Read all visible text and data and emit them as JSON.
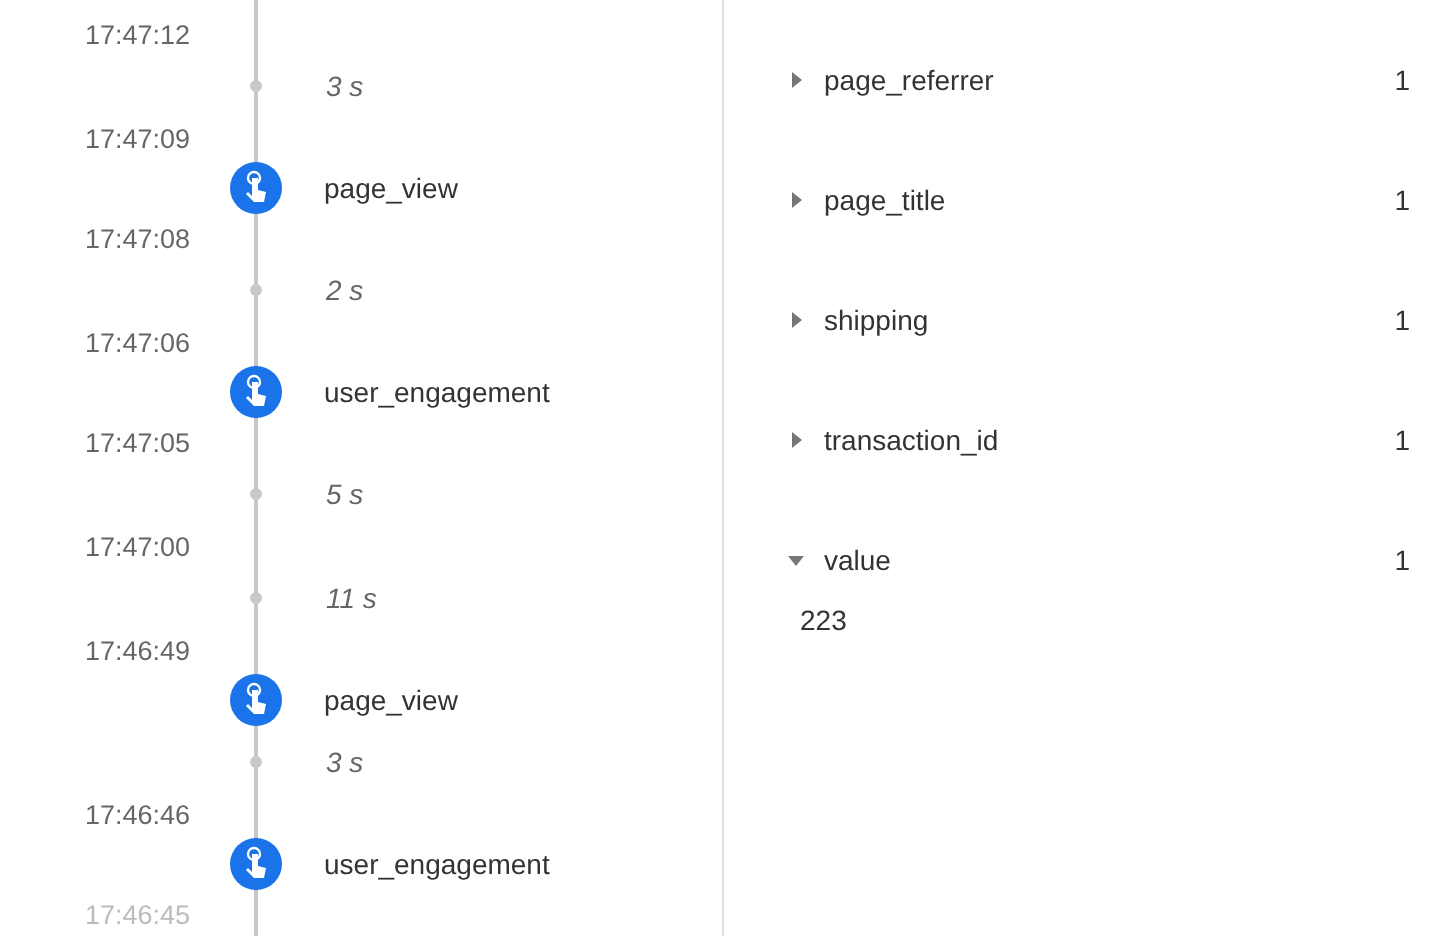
{
  "timeline": [
    {
      "kind": "time",
      "label": "17:47:12"
    },
    {
      "kind": "gap",
      "label": "3 s"
    },
    {
      "kind": "time",
      "label": "17:47:09"
    },
    {
      "kind": "event",
      "label": "page_view"
    },
    {
      "kind": "time",
      "label": "17:47:08"
    },
    {
      "kind": "gap",
      "label": "2 s"
    },
    {
      "kind": "time",
      "label": "17:47:06"
    },
    {
      "kind": "event",
      "label": "user_engagement"
    },
    {
      "kind": "time",
      "label": "17:47:05"
    },
    {
      "kind": "gap",
      "label": "5 s"
    },
    {
      "kind": "time",
      "label": "17:47:00"
    },
    {
      "kind": "gap",
      "label": "11 s"
    },
    {
      "kind": "time",
      "label": "17:46:49"
    },
    {
      "kind": "event",
      "label": "page_view"
    },
    {
      "kind": "gap",
      "label": "3 s"
    },
    {
      "kind": "time",
      "label": "17:46:46"
    },
    {
      "kind": "event",
      "label": "user_engagement"
    },
    {
      "kind": "time",
      "label": "17:46:45"
    }
  ],
  "parameters": [
    {
      "name": "page_referrer",
      "count": "1",
      "expanded": false
    },
    {
      "name": "page_title",
      "count": "1",
      "expanded": false
    },
    {
      "name": "shipping",
      "count": "1",
      "expanded": false
    },
    {
      "name": "transaction_id",
      "count": "1",
      "expanded": false
    },
    {
      "name": "value",
      "count": "1",
      "expanded": true,
      "value": "223"
    }
  ]
}
